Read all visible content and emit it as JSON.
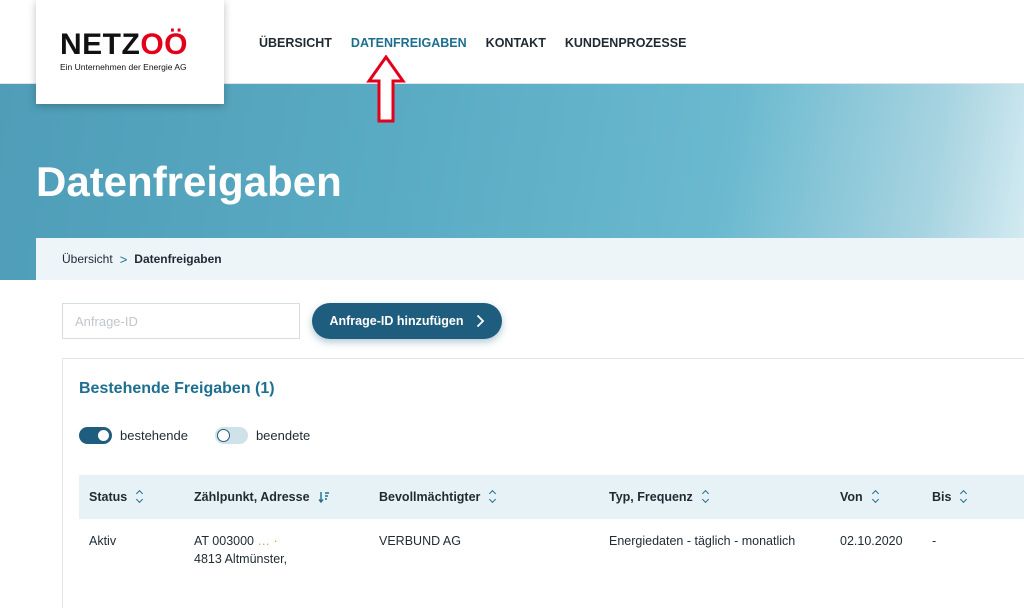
{
  "logo": {
    "brand_black": "NETZ",
    "brand_red": "OÖ",
    "tagline": "Ein Unternehmen der Energie AG",
    "brand_red_color": "#e2001a"
  },
  "nav": {
    "items": [
      {
        "label": "ÜBERSICHT"
      },
      {
        "label": "DATENFREIGABEN",
        "active": true
      },
      {
        "label": "KONTAKT"
      },
      {
        "label": "KUNDENPROZESSE"
      }
    ]
  },
  "hero": {
    "title": "Datenfreigaben"
  },
  "breadcrumb": {
    "home": "Übersicht",
    "separator": ">",
    "current": "Datenfreigaben"
  },
  "form": {
    "input_placeholder": "Anfrage-ID",
    "input_value": "",
    "add_button_label": "Anfrage-ID hinzufügen"
  },
  "section": {
    "title": "Bestehende Freigaben (1)",
    "toggles": [
      {
        "label": "bestehende",
        "on": true
      },
      {
        "label": "beendete",
        "on": false
      }
    ]
  },
  "table": {
    "columns": [
      {
        "label": "Status",
        "sort": "sortable"
      },
      {
        "label": "Zählpunkt, Adresse",
        "sort": "descending"
      },
      {
        "label": "Bevollmächtigter",
        "sort": "sortable"
      },
      {
        "label": "Typ, Frequenz",
        "sort": "sortable"
      },
      {
        "label": "Von",
        "sort": "sortable"
      },
      {
        "label": "Bis",
        "sort": "sortable"
      }
    ],
    "rows": [
      {
        "status": "Aktiv",
        "zaehlpunkt": "AT 003000",
        "zaehlpunkt_masked": "… ·",
        "adresse": "4813 Altmünster,",
        "bevollmaechtigter": "VERBUND AG",
        "typ": "Energiedaten - täglich - monatlich",
        "von": "02.10.2020",
        "bis": "-"
      }
    ]
  },
  "colors": {
    "accent": "#1d6f90",
    "button": "#1e5d7d",
    "annotation_arrow": "#e2001a"
  }
}
